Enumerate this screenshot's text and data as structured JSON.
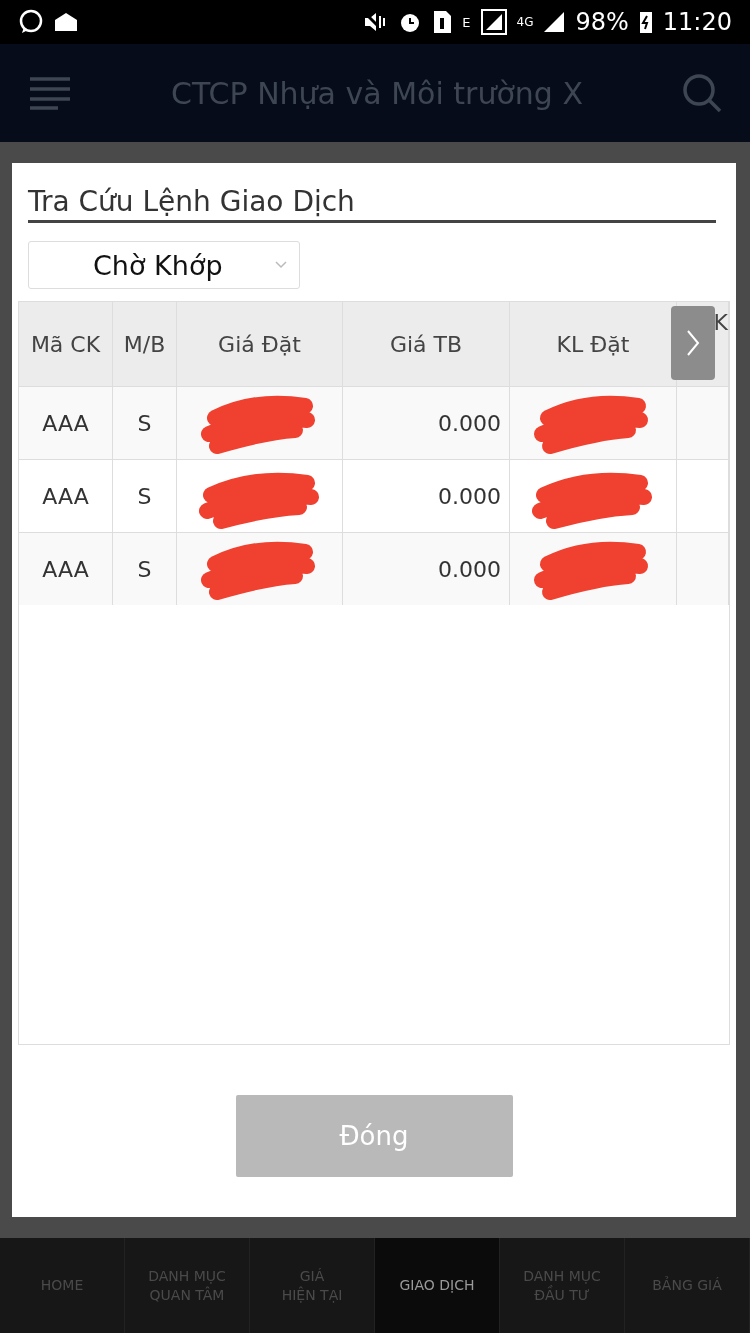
{
  "status_bar": {
    "network_type": "E",
    "network_type_2": "4G",
    "battery": "98%",
    "time": "11:20"
  },
  "app_bar": {
    "title": "CTCP Nhựa và Môi trường X"
  },
  "dialog": {
    "title": "Tra Cứu Lệnh Giao Dịch",
    "filter": {
      "value": "Chờ Khớp"
    },
    "table": {
      "columns": [
        "Mã CK",
        "M/B",
        "Giá Đặt",
        "Giá TB",
        "KL Đặt",
        "K"
      ],
      "rows": [
        {
          "cells": [
            {
              "kind": "text",
              "text": "AAA"
            },
            {
              "kind": "text",
              "text": "S"
            },
            {
              "kind": "redacted"
            },
            {
              "kind": "text",
              "text": "0.000"
            },
            {
              "kind": "redacted"
            }
          ]
        },
        {
          "cells": [
            {
              "kind": "text",
              "text": "AAA"
            },
            {
              "kind": "text",
              "text": "S"
            },
            {
              "kind": "redacted"
            },
            {
              "kind": "text",
              "text": "0.000"
            },
            {
              "kind": "redacted"
            }
          ]
        },
        {
          "cells": [
            {
              "kind": "text",
              "text": "AAA"
            },
            {
              "kind": "text",
              "text": "S"
            },
            {
              "kind": "redacted"
            },
            {
              "kind": "text",
              "text": "0.000"
            },
            {
              "kind": "redacted"
            }
          ]
        }
      ]
    },
    "close_button": "Đóng"
  },
  "bottom_nav": [
    {
      "lines": [
        "HOME"
      ],
      "selected": false
    },
    {
      "lines": [
        "DANH MỤC",
        "QUAN TÂM"
      ],
      "selected": false
    },
    {
      "lines": [
        "GIÁ",
        "HIỆN TẠI"
      ],
      "selected": false
    },
    {
      "lines": [
        "GIAO DỊCH"
      ],
      "selected": true
    },
    {
      "lines": [
        "DANH MỤC",
        "ĐẦU TƯ"
      ],
      "selected": false
    },
    {
      "lines": [
        "BẢNG GIÁ"
      ],
      "selected": false
    }
  ]
}
